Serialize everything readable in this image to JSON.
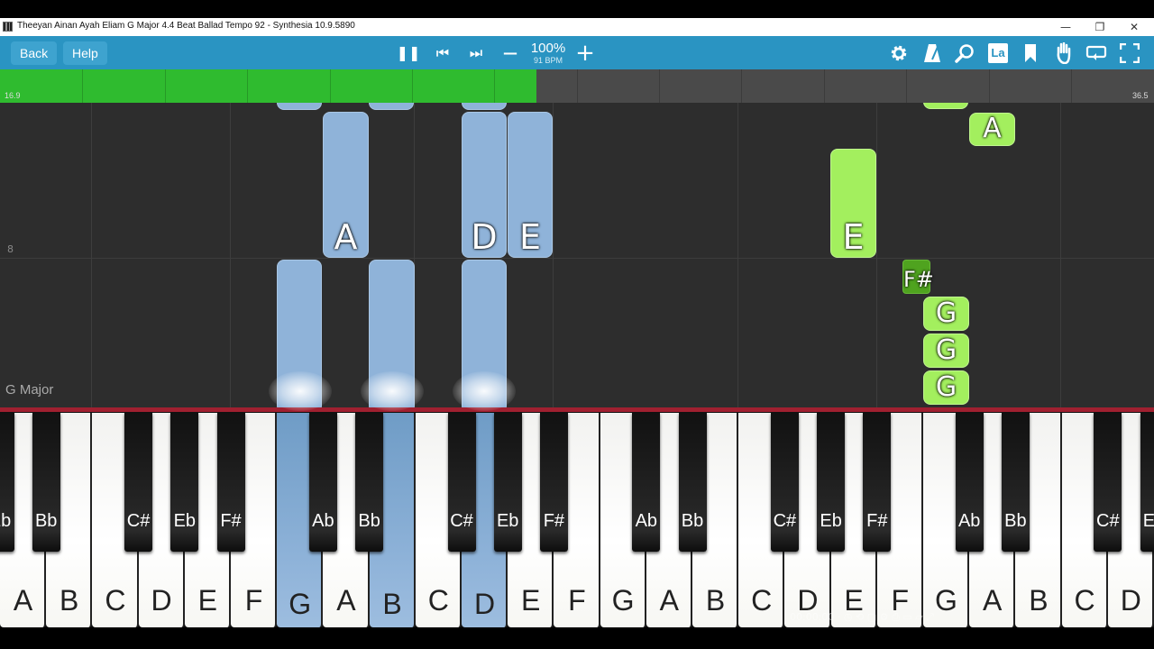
{
  "window": {
    "title": "Theeyan Ainan Ayah Eliam G Major 4.4 Beat Ballad Tempo 92 - Synthesia 10.9.5890",
    "minimize": "—",
    "restore": "❐",
    "close": "✕"
  },
  "toolbar": {
    "back_label": "Back",
    "help_label": "Help",
    "zoom": "100%",
    "bpm": "91 BPM",
    "pause_glyph": "❚❚",
    "prev_glyph": "⏮",
    "next_glyph": "⏭",
    "minus_glyph": "—",
    "plus_glyph": "+",
    "label_button": "La",
    "icons": [
      "gear-icon",
      "metronome-icon",
      "search-icon",
      "label-icon",
      "bookmark-icon",
      "hand-icon",
      "loop-icon",
      "fullscreen-icon"
    ]
  },
  "progress": {
    "start_label": "16.9",
    "end_label": "36.5",
    "fraction": 0.465,
    "color": "#2fbb2f"
  },
  "notes_area": {
    "measure_number": "8",
    "key_signature": "G Major"
  },
  "falling_notes": [
    {
      "hand": "left",
      "letter": "A"
    },
    {
      "hand": "left",
      "letter": "D"
    },
    {
      "hand": "left",
      "letter": "E"
    },
    {
      "hand": "left",
      "letter": ""
    },
    {
      "hand": "left",
      "letter": ""
    },
    {
      "hand": "left",
      "letter": ""
    },
    {
      "hand": "right",
      "letter": "A"
    },
    {
      "hand": "right",
      "letter": "E"
    },
    {
      "hand": "right",
      "letter": "F#"
    },
    {
      "hand": "right",
      "letter": "G"
    },
    {
      "hand": "right",
      "letter": "G"
    },
    {
      "hand": "right",
      "letter": "G"
    }
  ],
  "keyboard": {
    "white_keys": [
      "A",
      "B",
      "C",
      "D",
      "E",
      "F",
      "G",
      "A",
      "B",
      "C",
      "D",
      "E",
      "F",
      "G",
      "A",
      "B",
      "C",
      "D",
      "E",
      "F",
      "G",
      "A",
      "B",
      "C",
      "D"
    ],
    "black_keys": [
      "Eb",
      "Bb",
      "C#",
      "Eb",
      "F#",
      "Ab",
      "Bb",
      "C#",
      "Eb",
      "F#",
      "Ab",
      "Bb",
      "C#",
      "Eb",
      "F#",
      "Ab",
      "Bb",
      "C#",
      "Eb"
    ],
    "active_keys": [
      "G",
      "B",
      "D"
    ]
  },
  "colors": {
    "toolbar": "#2a94c2",
    "left_hand": "#8fb3d9",
    "right_hand": "#a3ef5e"
  }
}
